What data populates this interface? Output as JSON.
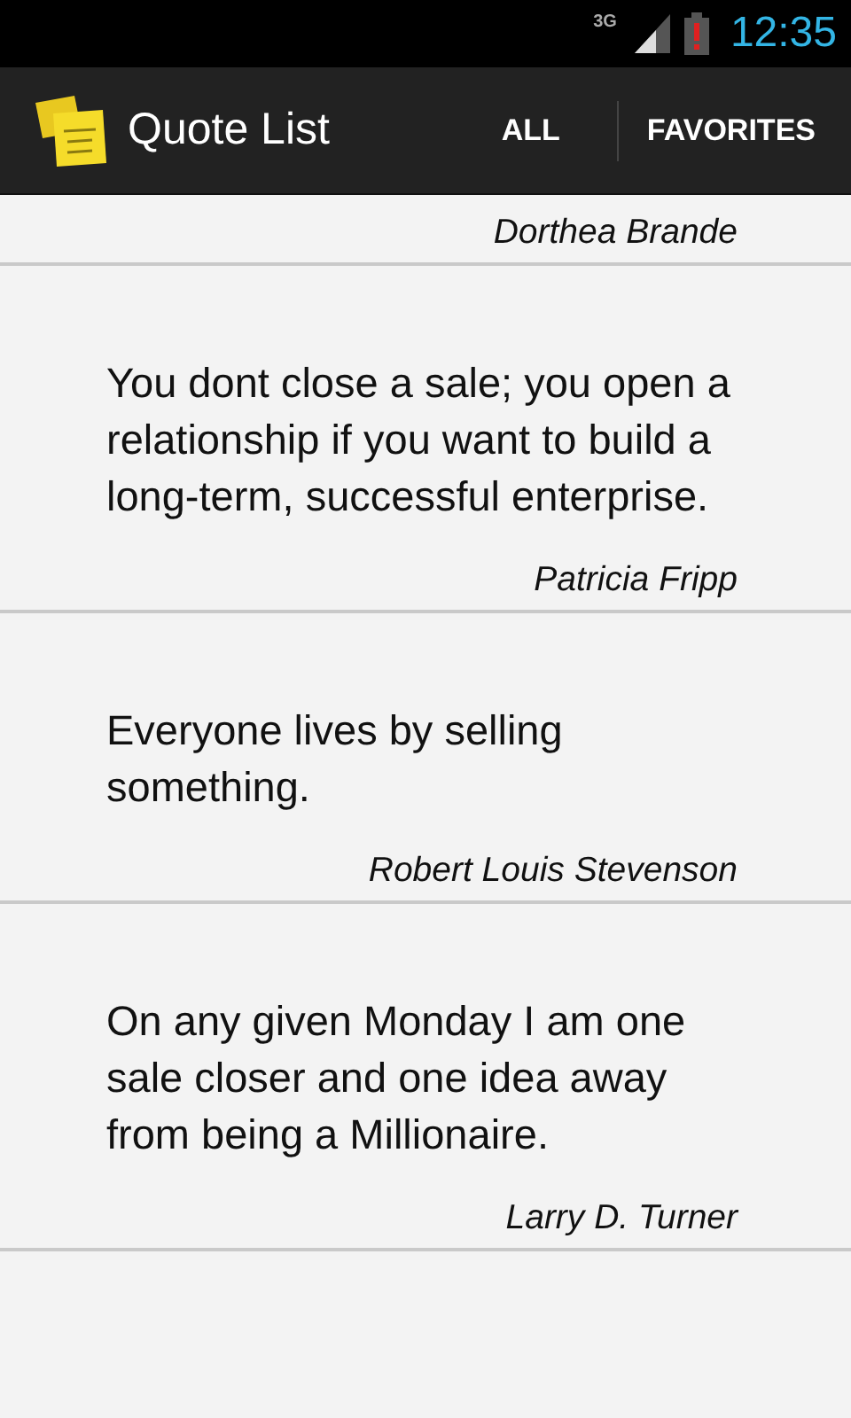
{
  "status_bar": {
    "network": "3G",
    "time": "12:35"
  },
  "action_bar": {
    "title": "Quote List",
    "tabs": [
      {
        "label": "ALL"
      },
      {
        "label": "FAVORITES"
      }
    ]
  },
  "quotes": [
    {
      "author": "Dorthea Brande"
    },
    {
      "text": "You dont close a sale; you open a relationship if you want to build a long-term, successful enterprise.",
      "author": "Patricia Fripp"
    },
    {
      "text": "Everyone lives by selling something.",
      "author": "Robert Louis Stevenson"
    },
    {
      "text": "On any given Monday I am one sale closer and one idea away from being a Millionaire.",
      "author": "Larry D. Turner"
    }
  ]
}
